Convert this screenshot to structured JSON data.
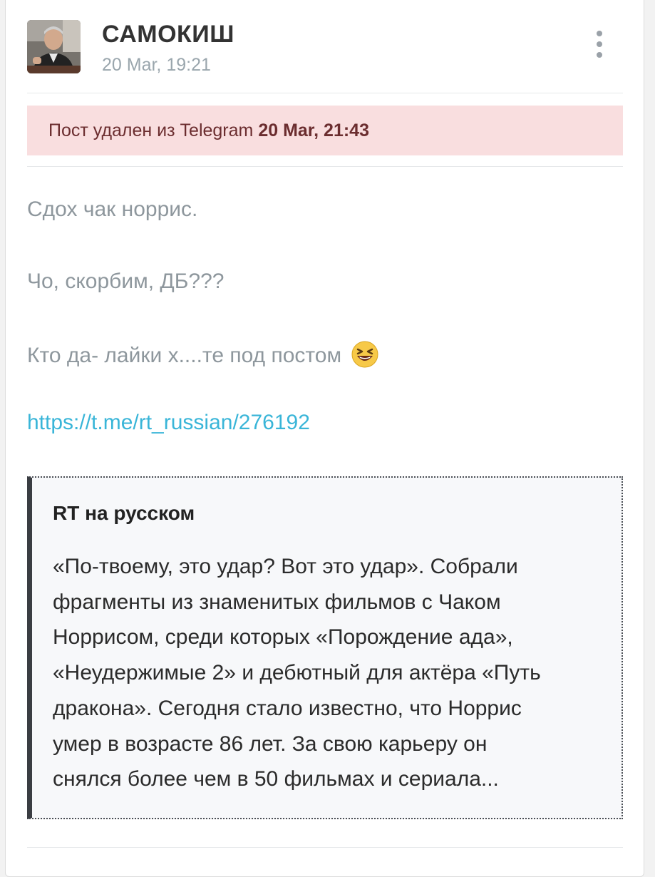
{
  "post": {
    "author": "САМОКИШ",
    "timestamp": "20 Mar, 19:21",
    "avatar_icon": "author-avatar",
    "menu_icon": "more-vertical-icon"
  },
  "deleted_notice": {
    "text": "Пост удален из Telegram",
    "date": "20 Mar, 21:43",
    "background": "#f9dedf"
  },
  "message": {
    "lines": [
      "Сдох чак норрис.",
      "Чо, скорбим, ДБ???",
      "Кто да- лайки х....те под постом"
    ],
    "emoji": "😆",
    "link": "https://t.me/rt_russian/276192"
  },
  "quote": {
    "title": "RT на русском",
    "lines": [
      "«По-твоему, это удар? Вот это удар». Собрали",
      "фрагменты из знаменитых фильмов с Чаком",
      "Норрисом, среди которых «Порождение ада»,",
      "«Неудержимые 2» и дебютный для актёра «Путь",
      "дракона». Сегодня стало известно, что Норрис",
      "умер в возрасте 86 лет. За свою карьеру он",
      "снялся более чем в 50 фильмах и сериала..."
    ]
  },
  "colors": {
    "link": "#39b5d8",
    "muted_text": "#8e979d",
    "deleted_text": "#6b2d2f"
  }
}
